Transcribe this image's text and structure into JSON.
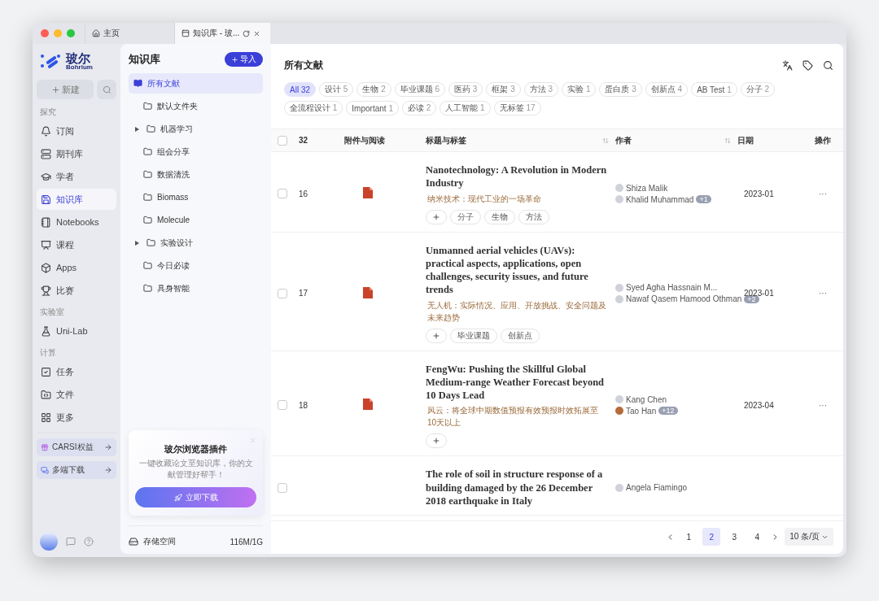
{
  "window": {
    "tabs": [
      {
        "label": "主页",
        "selected": false
      },
      {
        "label": "知识库 - 玻...",
        "selected": true
      }
    ]
  },
  "nav": {
    "logo": {
      "name": "玻尔",
      "sub": "Bohrium"
    },
    "new_button": "新建",
    "sections": [
      {
        "title": "探究",
        "items": [
          {
            "label": "订阅",
            "selected": false
          },
          {
            "label": "期刊库",
            "selected": false
          },
          {
            "label": "学者",
            "selected": false
          },
          {
            "label": "知识库",
            "selected": true
          },
          {
            "label": "Notebooks",
            "selected": false
          },
          {
            "label": "课程",
            "selected": false
          },
          {
            "label": "Apps",
            "selected": false
          },
          {
            "label": "比赛",
            "selected": false
          }
        ]
      },
      {
        "title": "实验室",
        "items": [
          {
            "label": "Uni-Lab",
            "selected": false
          }
        ]
      },
      {
        "title": "计算",
        "items": [
          {
            "label": "任务",
            "selected": false
          },
          {
            "label": "文件",
            "selected": false
          },
          {
            "label": "更多",
            "selected": false
          }
        ]
      }
    ],
    "promos": [
      "CARSI权益",
      "多端下载"
    ]
  },
  "library": {
    "title": "知识库",
    "import_button": "导入",
    "folders": [
      {
        "label": "所有文献",
        "selected": true,
        "kind": "all"
      },
      {
        "label": "默认文件夹",
        "selected": false,
        "kind": "folder"
      },
      {
        "label": "机器学习",
        "selected": false,
        "kind": "folder",
        "expanded": false
      },
      {
        "label": "组会分享",
        "selected": false,
        "kind": "folder"
      },
      {
        "label": "数据清洗",
        "selected": false,
        "kind": "folder"
      },
      {
        "label": "Biomass",
        "selected": false,
        "kind": "folder"
      },
      {
        "label": "Molecule",
        "selected": false,
        "kind": "folder"
      },
      {
        "label": "实验设计",
        "selected": false,
        "kind": "folder",
        "expanded": false
      },
      {
        "label": "今日必读",
        "selected": false,
        "kind": "folder"
      },
      {
        "label": "具身智能",
        "selected": false,
        "kind": "folder"
      }
    ],
    "plugin_card": {
      "title": "玻尔浏览器插件",
      "text": "一键收藏论文至知识库，你的文献管理好帮手！",
      "button": "立即下载"
    },
    "storage": {
      "label": "存储空间",
      "value": "116M/1G"
    }
  },
  "main": {
    "title": "所有文献",
    "tags": [
      {
        "label": "All",
        "count": "32",
        "selected": true
      },
      {
        "label": "设计",
        "count": "5",
        "selected": false
      },
      {
        "label": "生物",
        "count": "2",
        "selected": false
      },
      {
        "label": "毕业课题",
        "count": "6",
        "selected": false
      },
      {
        "label": "医药",
        "count": "3",
        "selected": false
      },
      {
        "label": "框架",
        "count": "3",
        "selected": false
      },
      {
        "label": "方法",
        "count": "3",
        "selected": false
      },
      {
        "label": "实验",
        "count": "1",
        "selected": false
      },
      {
        "label": "蛋白质",
        "count": "3",
        "selected": false
      },
      {
        "label": "创新点",
        "count": "4",
        "selected": false
      },
      {
        "label": "AB Test",
        "count": "1",
        "selected": false
      },
      {
        "label": "分子",
        "count": "2",
        "selected": false
      },
      {
        "label": "全流程设计",
        "count": "1",
        "selected": false
      },
      {
        "label": "Important",
        "count": "1",
        "selected": false
      },
      {
        "label": "必读",
        "count": "2",
        "selected": false
      },
      {
        "label": "人工智能",
        "count": "1",
        "selected": false
      },
      {
        "label": "无标签",
        "count": "17",
        "selected": false
      }
    ],
    "table": {
      "all_checked": false,
      "columns": [
        {
          "label": "32",
          "sortable": false
        },
        {
          "label": "附件与阅读",
          "sortable": false
        },
        {
          "label": "标题与标签",
          "sortable": true
        },
        {
          "label": "作者",
          "sortable": true
        },
        {
          "label": "日期",
          "sortable": false
        },
        {
          "label": "操作",
          "sortable": false
        }
      ],
      "rows": [
        {
          "checked": false,
          "number": "16",
          "has_pdf": true,
          "title": "Nanotechnology: A Revolution in Modern Industry",
          "translation": "纳米技术：现代工业的一场革命",
          "tags": [
            "分子",
            "生物",
            "方法"
          ],
          "authors": [
            {
              "name": "Shiza Malik",
              "photo": false
            },
            {
              "name": "Khalid Muhammad",
              "photo": false,
              "extra": "+1"
            }
          ],
          "date": "2023-01",
          "action": "···"
        },
        {
          "checked": false,
          "number": "17",
          "has_pdf": true,
          "title": "Unmanned aerial vehicles (UAVs): practical aspects, applications, open challenges, security issues, and future trends",
          "translation": "无人机：实际情况、应用、开放挑战、安全问题及未来趋势",
          "tags": [
            "毕业课题",
            "创新点"
          ],
          "authors": [
            {
              "name": "Syed Agha Hassnain M...",
              "photo": false
            },
            {
              "name": "Nawaf Qasem Hamood Othman",
              "photo": false,
              "extra": "+2"
            }
          ],
          "date": "2023-01",
          "action": "···"
        },
        {
          "checked": false,
          "number": "18",
          "has_pdf": true,
          "title": "FengWu: Pushing the Skillful Global Medium-range Weather Forecast beyond 10 Days Lead",
          "translation": "风云：将全球中期数值预报有效预报时效拓展至10天以上",
          "tags": [],
          "authors": [
            {
              "name": "Kang Chen",
              "photo": false
            },
            {
              "name": "Tao Han",
              "photo": true,
              "extra": "+12"
            }
          ],
          "date": "2023-04",
          "action": "···"
        },
        {
          "checked": false,
          "title": "The role of soil in structure response of a building damaged by the 26 December 2018 earthquake in Italy",
          "authors": [
            {
              "name": "Angela Fiamingo",
              "photo": false
            }
          ]
        }
      ]
    },
    "pagination": {
      "pages": [
        {
          "label": "1",
          "selected": false
        },
        {
          "label": "2",
          "selected": true
        },
        {
          "label": "3",
          "selected": false
        },
        {
          "label": "4",
          "selected": false
        }
      ],
      "page_size": "10 条/页"
    }
  }
}
